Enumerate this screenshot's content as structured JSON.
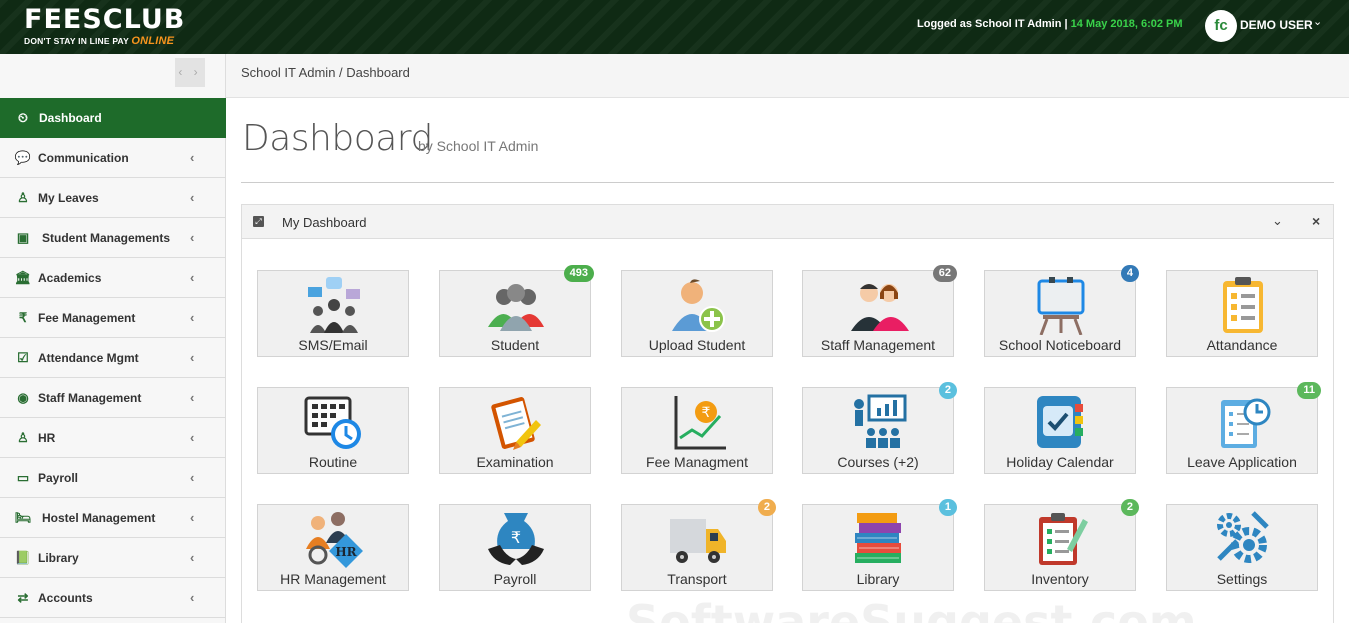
{
  "header": {
    "logo_main": "FEESCLUB",
    "logo_tagline": "DON'T STAY IN LINE PAY",
    "logo_online": "ONLINE",
    "logged_as": "Logged as School IT Admin",
    "separator": "|",
    "datetime": "14 May 2018, 6:02 PM",
    "avatar_text": "fc",
    "user_name": "DEMO USER",
    "user_caret": "⌄"
  },
  "sidebar": {
    "toggle": "‹ ›",
    "items": [
      {
        "label": "Dashboard",
        "icon": "dashboard-icon",
        "glyph": "⏲",
        "chevron": ""
      },
      {
        "label": "Communication",
        "icon": "comments-icon",
        "glyph": "💬",
        "chevron": "‹"
      },
      {
        "label": "My Leaves",
        "icon": "user-leave-icon",
        "glyph": "♙",
        "chevron": "‹"
      },
      {
        "label": "Student Managements",
        "icon": "id-card-icon",
        "glyph": "▣",
        "chevron": "‹"
      },
      {
        "label": "Academics",
        "icon": "institution-icon",
        "glyph": "🏛",
        "chevron": "‹"
      },
      {
        "label": "Fee Management",
        "icon": "rupee-icon",
        "glyph": "₹",
        "chevron": "‹"
      },
      {
        "label": "Attendance Mgmt",
        "icon": "check-square-icon",
        "glyph": "☑",
        "chevron": "‹"
      },
      {
        "label": "Staff Management",
        "icon": "user-circle-icon",
        "glyph": "◉",
        "chevron": "‹"
      },
      {
        "label": "HR",
        "icon": "users-icon",
        "glyph": "♙",
        "chevron": "‹"
      },
      {
        "label": "Payroll",
        "icon": "credit-card-icon",
        "glyph": "▭",
        "chevron": "‹"
      },
      {
        "label": "Hostel Management",
        "icon": "bed-icon",
        "glyph": "🛏",
        "chevron": "‹"
      },
      {
        "label": "Library",
        "icon": "book-icon",
        "glyph": "📗",
        "chevron": "‹"
      },
      {
        "label": "Accounts",
        "icon": "exchange-icon",
        "glyph": "⇄",
        "chevron": "‹"
      }
    ]
  },
  "breadcrumb": "School IT Admin / Dashboard",
  "page": {
    "title": "Dashboard",
    "subtitle": "by School IT Admin"
  },
  "panel": {
    "title": "My Dashboard",
    "collapse": "⌄",
    "close": "×",
    "expand_glyph": "⤢"
  },
  "tiles": [
    {
      "label": "SMS/Email",
      "icon": "sms-email-icon",
      "badge": "",
      "badge_color": ""
    },
    {
      "label": "Student",
      "icon": "student-icon",
      "badge": "493",
      "badge_color": "#4cae4c"
    },
    {
      "label": "Upload Student",
      "icon": "upload-student-icon",
      "badge": "",
      "badge_color": ""
    },
    {
      "label": "Staff Management",
      "icon": "staff-management-icon",
      "badge": "62",
      "badge_color": "#777777"
    },
    {
      "label": "School Noticeboard",
      "icon": "noticeboard-icon",
      "badge": "4",
      "badge_color": "#337ab7"
    },
    {
      "label": "Attandance",
      "icon": "attendance-icon",
      "badge": "",
      "badge_color": ""
    },
    {
      "label": "Routine",
      "icon": "routine-icon",
      "badge": "",
      "badge_color": ""
    },
    {
      "label": "Examination",
      "icon": "examination-icon",
      "badge": "",
      "badge_color": ""
    },
    {
      "label": "Fee Managment",
      "icon": "fee-management-icon",
      "badge": "",
      "badge_color": ""
    },
    {
      "label": "Courses (+2)",
      "icon": "courses-icon",
      "badge": "2",
      "badge_color": "#5bc0de"
    },
    {
      "label": "Holiday Calendar",
      "icon": "holiday-calendar-icon",
      "badge": "",
      "badge_color": ""
    },
    {
      "label": "Leave Application",
      "icon": "leave-application-icon",
      "badge": "11",
      "badge_color": "#5cb85c"
    },
    {
      "label": "HR Management",
      "icon": "hr-management-icon",
      "badge": "",
      "badge_color": ""
    },
    {
      "label": "Payroll",
      "icon": "payroll-icon",
      "badge": "",
      "badge_color": ""
    },
    {
      "label": "Transport",
      "icon": "transport-icon",
      "badge": "2",
      "badge_color": "#f0ad4e"
    },
    {
      "label": "Library",
      "icon": "library-icon",
      "badge": "1",
      "badge_color": "#5bc0de"
    },
    {
      "label": "Inventory",
      "icon": "inventory-icon",
      "badge": "2",
      "badge_color": "#5cb85c"
    },
    {
      "label": "Settings",
      "icon": "settings-icon",
      "badge": "",
      "badge_color": ""
    }
  ],
  "colors": {
    "brand_green": "#1e6b2a",
    "topbar": "#0f2a14",
    "date_green": "#39d24a",
    "logo_orange": "#f7941d"
  }
}
